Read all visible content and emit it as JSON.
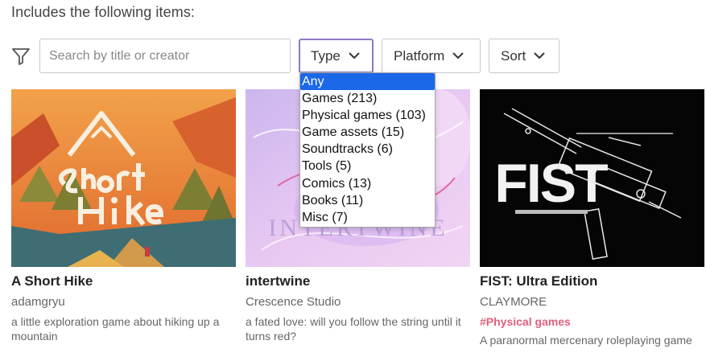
{
  "section": {
    "title": "Includes the following items:"
  },
  "filters": {
    "search_placeholder": "Search by title or creator",
    "type_label": "Type",
    "platform_label": "Platform",
    "sort_label": "Sort"
  },
  "type_menu": {
    "options": [
      "Any",
      "Games (213)",
      "Physical games (103)",
      "Game assets (15)",
      "Soundtracks (6)",
      "Tools (5)",
      "Comics (13)",
      "Books (11)",
      "Misc (7)"
    ],
    "selected": "Any"
  },
  "items": [
    {
      "title": "A Short Hike",
      "creator": "adamgryu",
      "tag": "",
      "description": "a little exploration game about hiking up a mountain",
      "thumb_text": ""
    },
    {
      "title": "intertwine",
      "creator": "Crescence Studio",
      "tag": "",
      "description": "a fated love: will you follow the string until it turns red?",
      "thumb_text": "INTERTWINE"
    },
    {
      "title": "FIST: Ultra Edition",
      "creator": "CLAYMORE",
      "tag": "#Physical games",
      "description": "A paranormal mercenary roleplaying game",
      "thumb_text": "FIST"
    }
  ],
  "colors": {
    "accent_border": "#8f78c4",
    "menu_selected": "#1a67e8",
    "tag": "#e0607e"
  }
}
